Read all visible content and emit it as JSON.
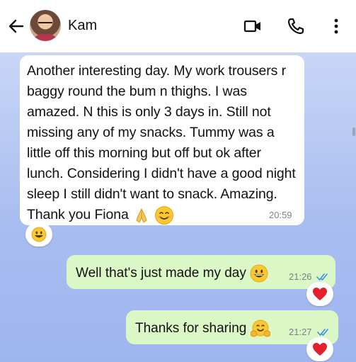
{
  "header": {
    "contact_name": "Kam",
    "back_icon": "arrow-left-icon",
    "video_icon": "video-camera-icon",
    "call_icon": "phone-icon",
    "menu_icon": "more-vertical-icon"
  },
  "messages": [
    {
      "direction": "incoming",
      "text": "Another interesting day. My work trousers r baggy round the bum n thighs. I was amazed. N this is only 3 days in. Still not missing any of my snacks. Tummy was a little off this morning but off but ok after lunch. Considering  I didn't have a good night sleep I still didn't want to snack. Amazing. Thank you Fiona",
      "emojis": [
        "folded-hands-emoji",
        "smiling-face-emoji"
      ],
      "time": "20:59",
      "reaction": "grinning-face-emoji"
    },
    {
      "direction": "outgoing",
      "text": "Well that's just made my day",
      "emoji": "grinning-face-emoji",
      "time": "21:26",
      "status": "read",
      "reaction": "red-heart-emoji"
    },
    {
      "direction": "outgoing",
      "text": "Thanks for sharing",
      "emoji": "hugging-face-emoji",
      "time": "21:27",
      "status": "read",
      "reaction": "red-heart-emoji"
    }
  ],
  "colors": {
    "incoming_bubble": "#ffffff",
    "outgoing_bubble": "#dbf7c6",
    "read_ticks": "#3b8ee8",
    "chat_background": "#aebff0"
  }
}
